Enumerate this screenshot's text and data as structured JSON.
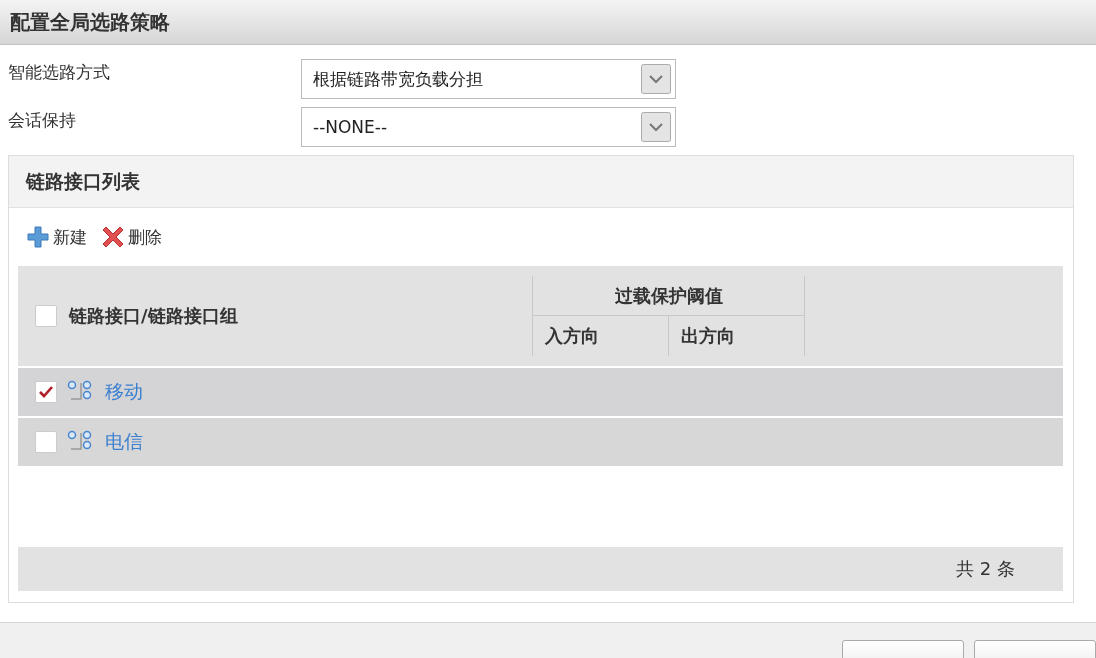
{
  "dialog": {
    "title": "配置全局选路策略"
  },
  "form": [
    {
      "label": "智能选路方式",
      "value": "根据链路带宽负载分担"
    },
    {
      "label": "会话保持",
      "value": "--NONE--"
    }
  ],
  "panel": {
    "title": "链路接口列表",
    "toolbar": [
      {
        "kind": "add",
        "label": "新建"
      },
      {
        "kind": "delete",
        "label": "删除"
      }
    ],
    "table": {
      "select_all": {
        "checked": false
      },
      "name_column": "链路接口/链路接口组",
      "group_column": "过载保护阈值",
      "sub_columns": [
        "入方向",
        "出方向"
      ],
      "rows": [
        {
          "name": "移动",
          "checked": true
        },
        {
          "name": "电信",
          "checked": false
        }
      ],
      "footer": "共 2 条"
    }
  }
}
